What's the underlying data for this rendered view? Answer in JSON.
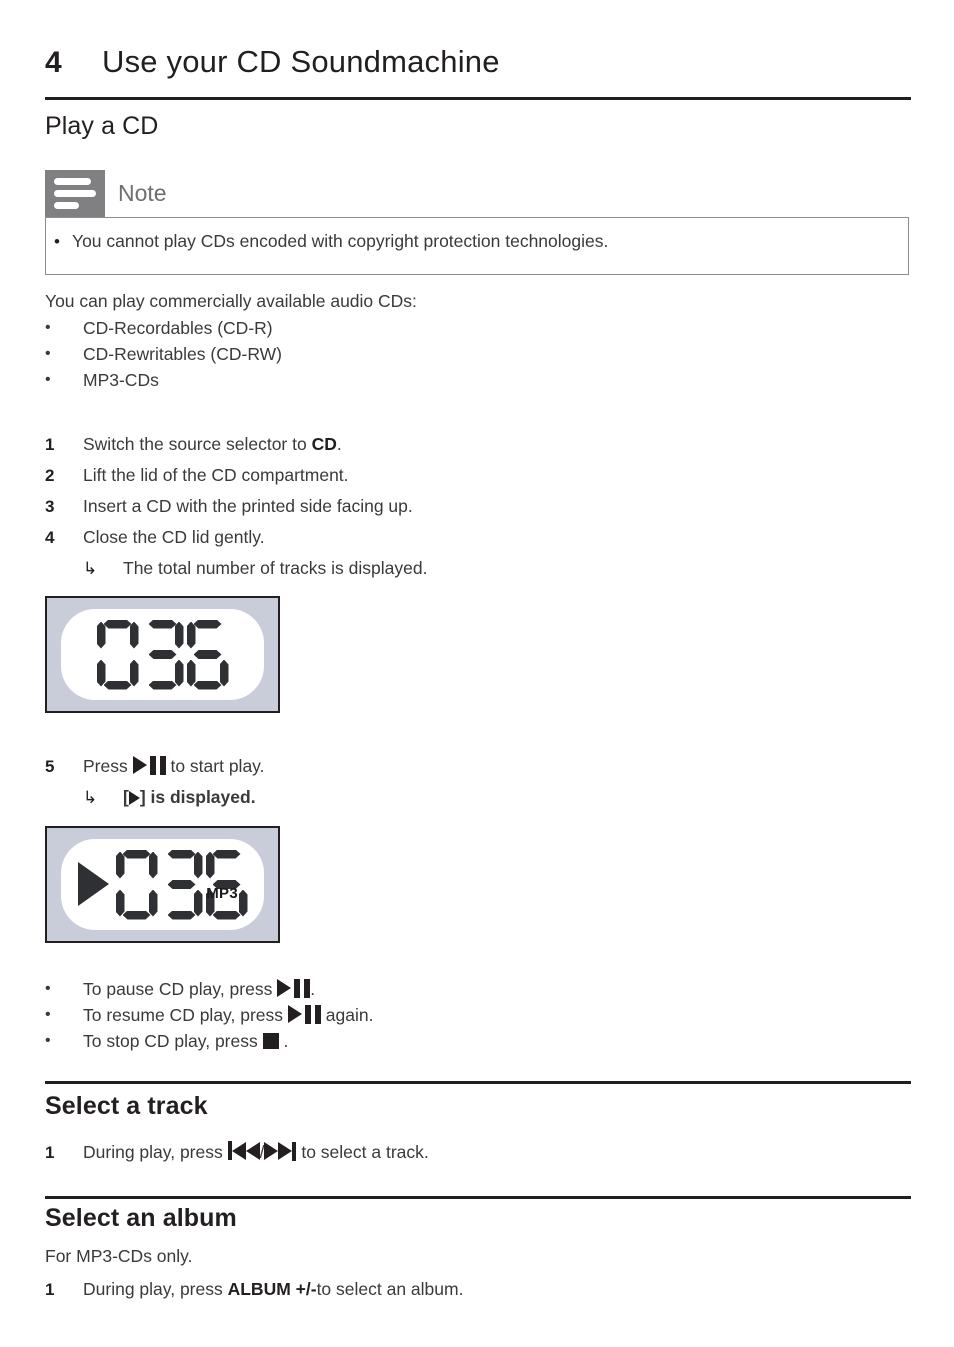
{
  "document": {
    "chapter_number": "4",
    "chapter_title": "Use your CD Soundmachine"
  },
  "sections": {
    "play_cd": {
      "heading": "Play a CD",
      "note": {
        "icon": "note-icon",
        "title": "Note",
        "items": [
          "You cannot play CDs encoded with copyright protection technologies."
        ]
      },
      "intro": "You can play commercially available audio CDs:",
      "formats": [
        "CD-Recordables (CD-R)",
        "CD-Rewritables (CD-RW)",
        "MP3-CDs"
      ],
      "steps": [
        {
          "num": "1",
          "pre": "Switch the source selector to ",
          "bold": "CD",
          "post": "."
        },
        {
          "num": "2",
          "pre": "Lift the lid of the CD compartment.",
          "bold": "",
          "post": ""
        },
        {
          "num": "3",
          "pre": "Insert a CD with the printed side facing up.",
          "bold": "",
          "post": ""
        },
        {
          "num": "4",
          "pre": "Close the CD lid gently.",
          "bold": "",
          "post": ""
        }
      ],
      "substep_1": "The total number of tracks is displayed.",
      "step5": {
        "num": "5",
        "pre": "Press ",
        "post": " to start play."
      },
      "substep_2_pre": "[",
      "substep_2_post": "] is displayed.",
      "controls": [
        {
          "pre": "To pause CD play, press ",
          "post": "."
        },
        {
          "pre": "To resume CD play, press ",
          "post": " again."
        },
        {
          "pre": "To stop CD play, press ",
          "post": " ."
        }
      ]
    },
    "select_track": {
      "heading": "Select a track",
      "step": {
        "num": "1",
        "pre": "During play, press ",
        "mid": "/",
        "post": " to select a track."
      }
    },
    "select_album": {
      "heading": "Select an album",
      "note_line": "For MP3-CDs only.",
      "step": {
        "num": "1",
        "pre": "During play, press ",
        "bold": "ALBUM +/-",
        "post": "to select an album."
      }
    }
  },
  "figures": {
    "display_1": {
      "name": "lcd-display-track-count",
      "digits": "036",
      "play_indicator": false,
      "mp3_label": ""
    },
    "display_2": {
      "name": "lcd-display-playing",
      "digits": "036",
      "play_indicator": true,
      "mp3_label": "MP3"
    }
  },
  "glyphs": {
    "play_pause": "play-pause-icon",
    "stop": "stop-icon",
    "prev": "skip-previous-icon",
    "next": "skip-next-icon",
    "arrow": "↳",
    "bullet": "•"
  },
  "colors": {
    "text": "#3a3a3c",
    "heading": "#231f20",
    "note_icon_bg": "#808083",
    "note_title": "#6f6f71",
    "lcd_frame": "#c9cdd9",
    "lcd_segment": "#2e3033"
  }
}
